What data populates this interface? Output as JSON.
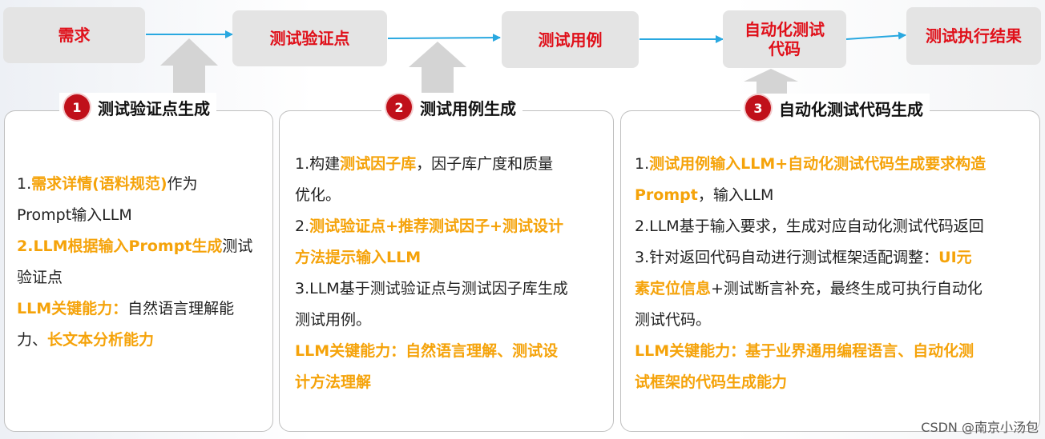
{
  "flow": {
    "steps": [
      "需求",
      "测试验证点",
      "测试用例",
      "自动化测试代码",
      "测试执行结果"
    ]
  },
  "cards": [
    {
      "number": "1",
      "title": "测试验证点生成",
      "lines": [
        [
          {
            "t": "1."
          },
          {
            "t": "需求详情(语料规范)",
            "h": true
          },
          {
            "t": "作为"
          }
        ],
        [
          {
            "t": "Prompt输入LLM"
          }
        ],
        [
          {
            "t": "2.LLM根据输入Prompt生成",
            "h": true
          },
          {
            "t": "测试"
          }
        ],
        [
          {
            "t": "验证点"
          }
        ],
        [
          {
            "t": "LLM关键能力：",
            "h": true
          },
          {
            "t": "自然语言理解能"
          }
        ],
        [
          {
            "t": "力、"
          },
          {
            "t": "长文本分析能力",
            "h": true
          }
        ]
      ]
    },
    {
      "number": "2",
      "title": "测试用例生成",
      "lines": [
        [
          {
            "t": "1.构建"
          },
          {
            "t": "测试因子库",
            "h": true
          },
          {
            "t": "，因子库广度和质量"
          }
        ],
        [
          {
            "t": "优化。"
          }
        ],
        [
          {
            "t": "2."
          },
          {
            "t": "测试验证点+推荐测试因子+测试设计",
            "h": true
          }
        ],
        [
          {
            "t": "方法提示输入LLM",
            "h": true
          }
        ],
        [
          {
            "t": "3.LLM基于测试验证点与测试因子库生成"
          }
        ],
        [
          {
            "t": "测试用例。"
          }
        ],
        [
          {
            "t": "LLM关键能力：自然语言理解、测试设",
            "h": true
          }
        ],
        [
          {
            "t": "计方法理解",
            "h": true
          }
        ]
      ]
    },
    {
      "number": "3",
      "title": "自动化测试代码生成",
      "lines": [
        [
          {
            "t": "1."
          },
          {
            "t": "测试用例输入LLM+自动化测试代码生成要求构造",
            "h": true
          }
        ],
        [
          {
            "t": "Prompt",
            "h": true
          },
          {
            "t": "，输入LLM"
          }
        ],
        [
          {
            "t": "2.LLM基于输入要求，生成对应自动化测试代码返回"
          }
        ],
        [
          {
            "t": "3.针对返回代码自动进行测试框架适配调整："
          },
          {
            "t": "UI元",
            "h": true
          }
        ],
        [
          {
            "t": "素定位信息",
            "h": true
          },
          {
            "t": "+测试断言补充，最终生成可执行自动化"
          }
        ],
        [
          {
            "t": "测试代码。"
          }
        ],
        [
          {
            "t": "LLM关键能力：基于业界通用编程语言、自动化测",
            "h": true
          }
        ],
        [
          {
            "t": "试框架的代码生成能力",
            "h": true
          }
        ]
      ]
    }
  ],
  "watermark": "CSDN @南京小汤包"
}
